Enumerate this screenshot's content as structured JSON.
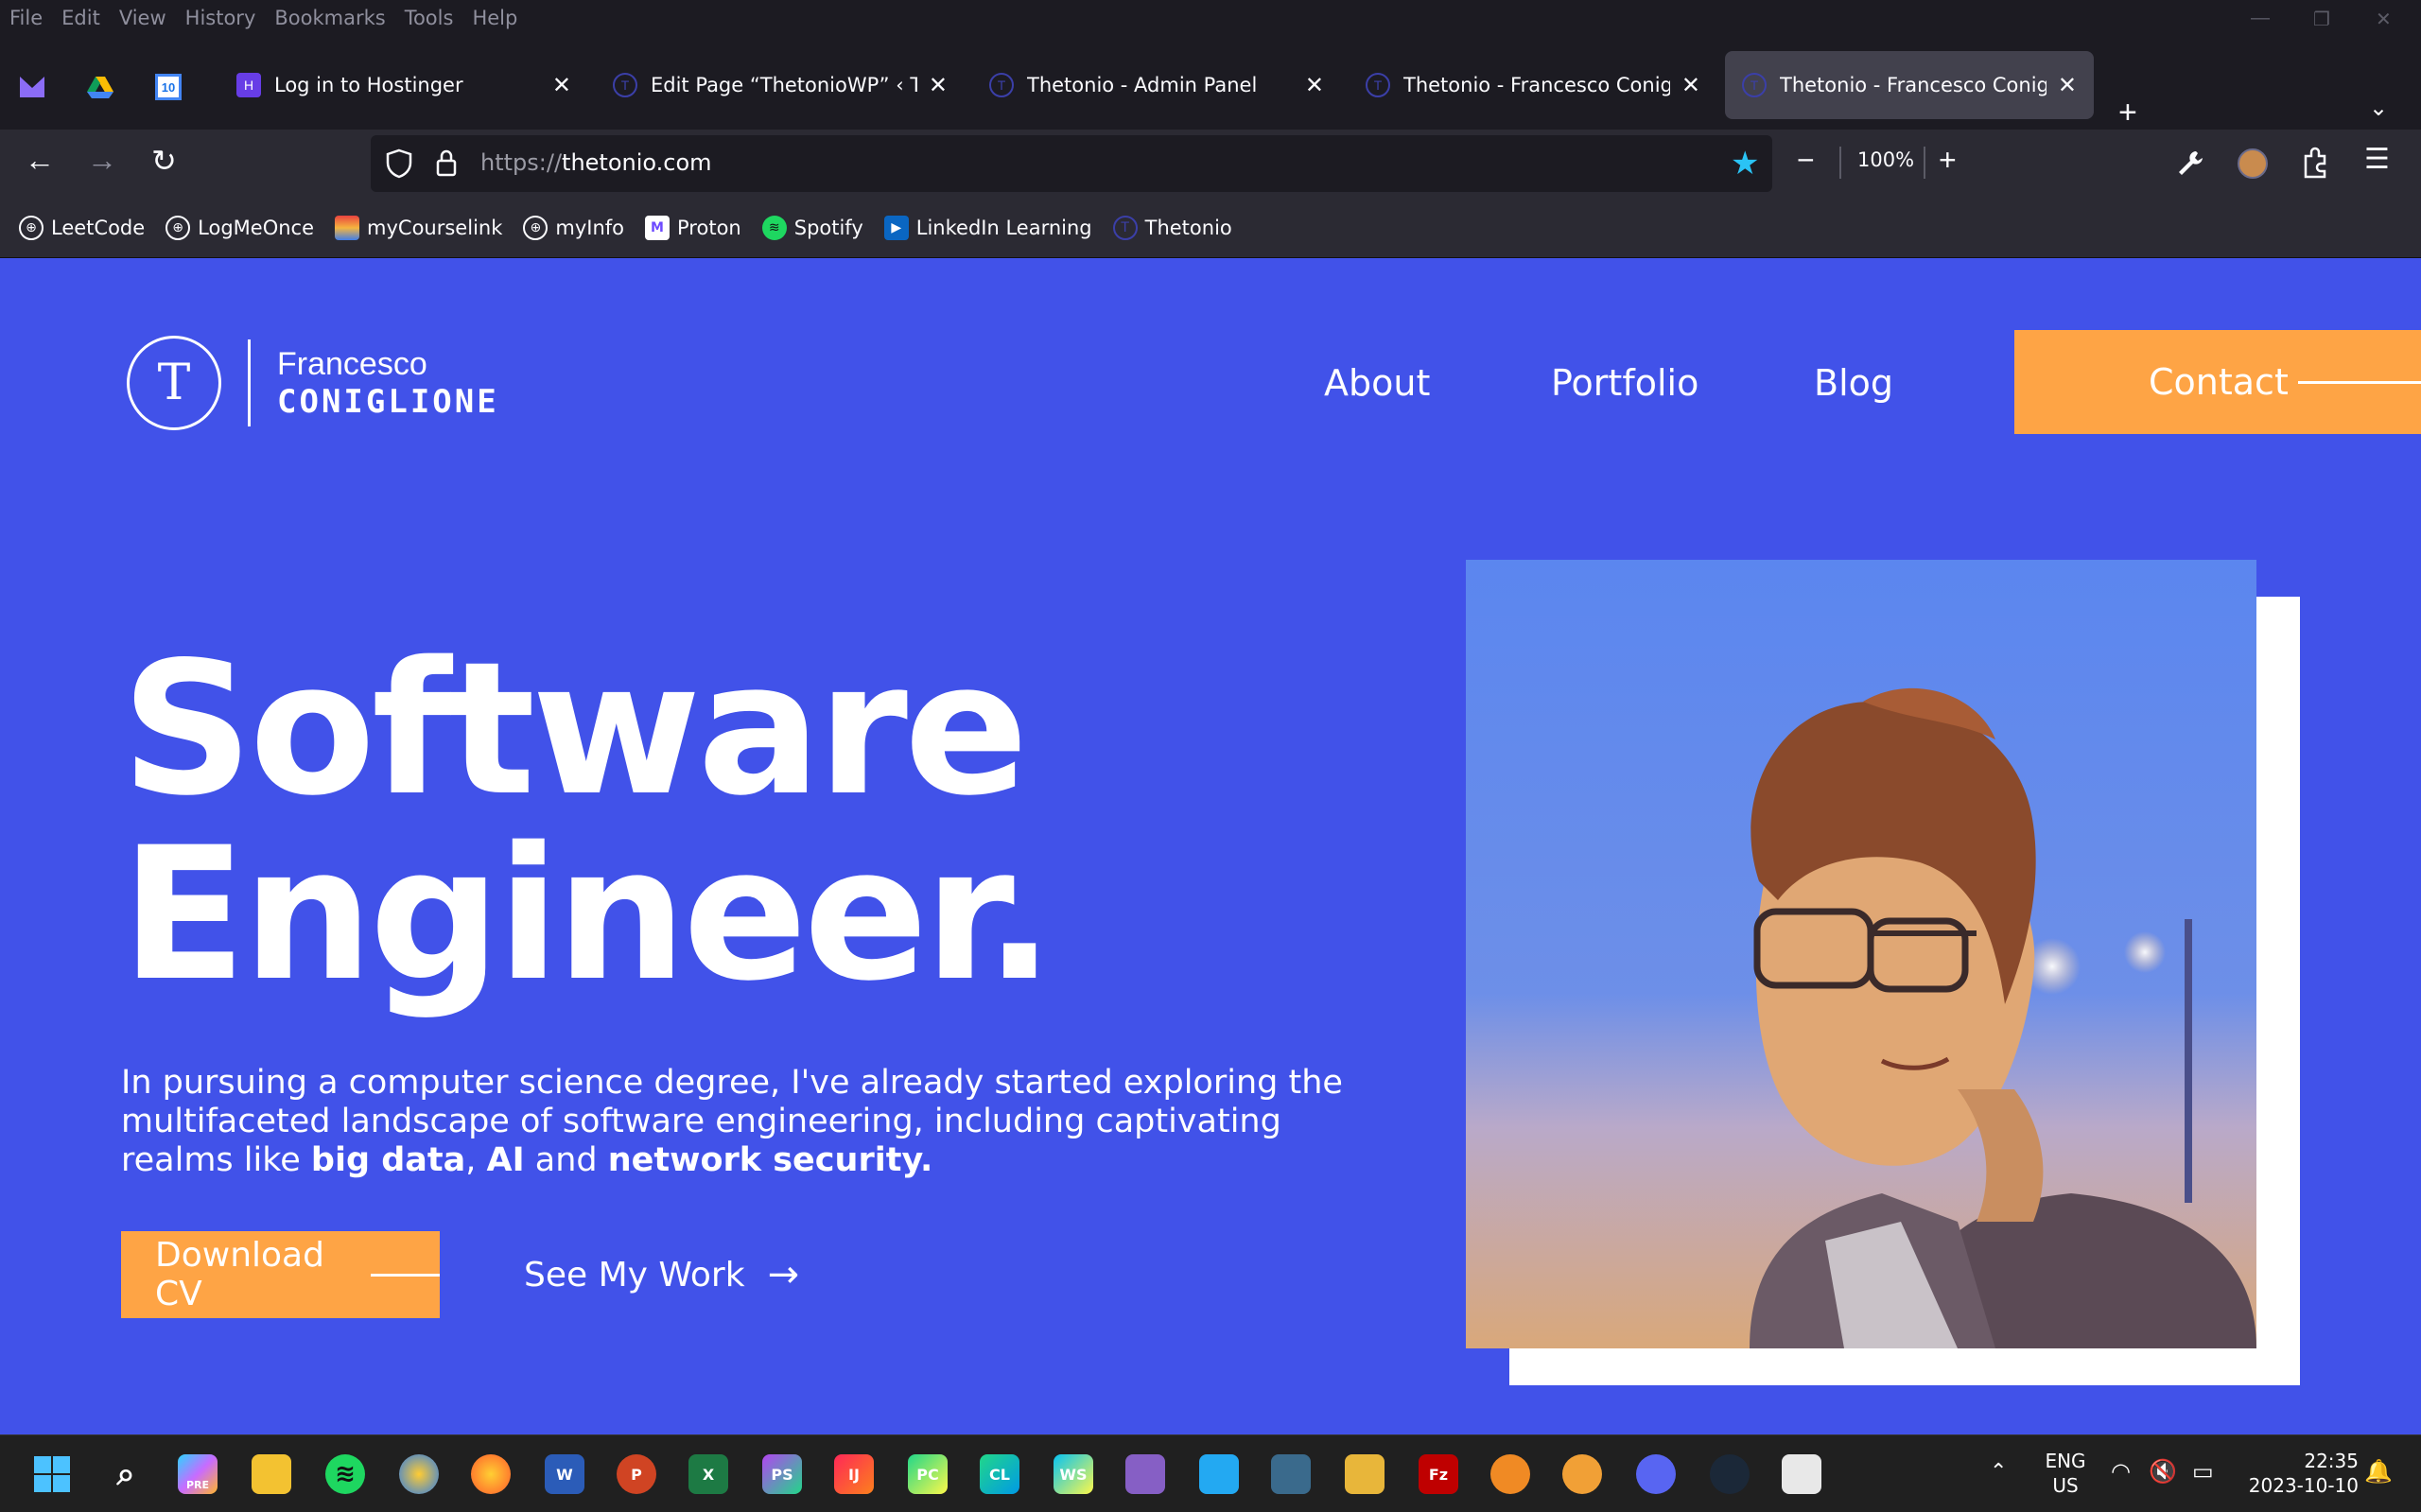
{
  "menubar": {
    "items": [
      "File",
      "Edit",
      "View",
      "History",
      "Bookmarks",
      "Tools",
      "Help"
    ]
  },
  "tabs": [
    {
      "title": "Log in to Hostinger",
      "icon": "hostinger-icon"
    },
    {
      "title": "Edit Page “ThetonioWP” ‹ Thetonio",
      "icon": "wordpress-icon"
    },
    {
      "title": "Thetonio - Admin Panel",
      "icon": "thetonio-icon"
    },
    {
      "title": "Thetonio - Francesco Coniglione",
      "icon": "thetonio-icon"
    },
    {
      "title": "Thetonio - Francesco Coniglione",
      "icon": "thetonio-icon",
      "active": true
    }
  ],
  "navbar": {
    "url_protocol": "https://",
    "url_host": "thetonio.com",
    "zoom": "100%"
  },
  "bookmarks": [
    "LeetCode",
    "LogMeOnce",
    "myCourselink",
    "myInfo",
    "Proton",
    "Spotify",
    "LinkedIn Learning",
    "Thetonio"
  ],
  "site": {
    "logo_letter": "T",
    "logo_first": "Francesco",
    "logo_last": "CONIGLIONE",
    "nav": {
      "about": "About",
      "portfolio": "Portfolio",
      "blog": "Blog",
      "contact": "Contact"
    },
    "hero_line1": "Software",
    "hero_line2": "Engineer.",
    "desc_pre": "In pursuing a computer science degree, I've already started exploring the multifaceted landscape of software engineering, including captivating realms like ",
    "desc_b1": "big data",
    "desc_sep1": ", ",
    "desc_b2": "AI",
    "desc_sep2": " and ",
    "desc_b3": "network security.",
    "download_label": "Download CV",
    "seework_label": "See My Work",
    "colors": {
      "bg": "#4152e9",
      "accent": "#fea445"
    }
  },
  "taskbar": {
    "lang1": "ENG",
    "lang2": "US",
    "time": "22:35",
    "date": "2023-10-10",
    "apps": [
      {
        "name": "copilot",
        "label": "PRE"
      },
      {
        "name": "ps",
        "label": "PS"
      },
      {
        "name": "ij",
        "label": "IJ"
      },
      {
        "name": "pc",
        "label": "PC"
      },
      {
        "name": "cl",
        "label": "CL"
      },
      {
        "name": "ws",
        "label": "WS"
      },
      {
        "name": "word",
        "label": "W"
      },
      {
        "name": "excel",
        "label": "X"
      },
      {
        "name": "filezilla",
        "label": "Fz"
      }
    ]
  }
}
